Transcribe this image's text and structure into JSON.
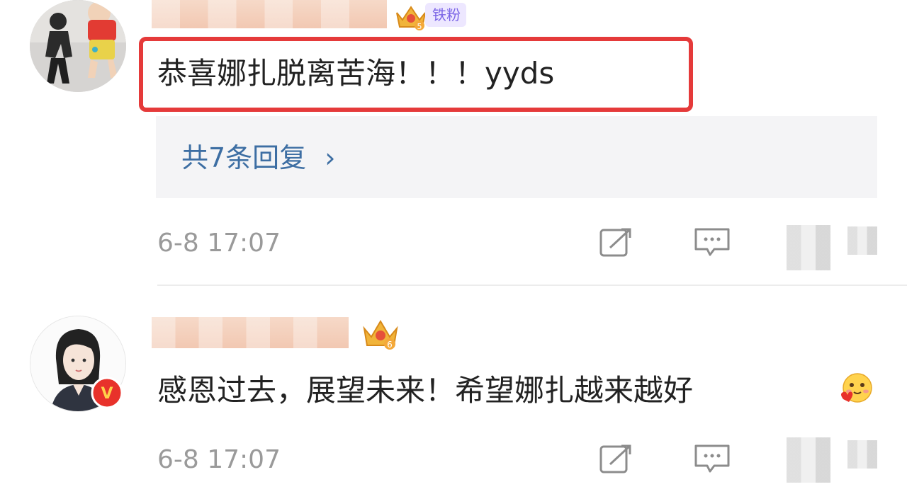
{
  "comments": [
    {
      "fan_badge": "铁粉",
      "crown_level": "5",
      "text": "恭喜娜扎脱离苦海！！！yyds",
      "replies_link": "共7条回复",
      "replies_chevron": "›",
      "timestamp": "6-8 17:07"
    },
    {
      "crown_level": "6",
      "text": "感恩过去，展望未来！希望娜扎越来越好",
      "timestamp": "6-8 17:07",
      "verified_mark": "V"
    }
  ],
  "colors": {
    "highlight": "#e53a3a",
    "link": "#3d6ea3",
    "fan_badge_bg": "#ede7ff",
    "fan_badge_text": "#7a64e6",
    "verified": "#e8322b",
    "timestamp": "#9a9a9a"
  },
  "icons": {
    "share": "share-icon",
    "comment": "comment-icon",
    "crown": "crown-icon",
    "emoji": "blush-hug-emoji-icon"
  }
}
